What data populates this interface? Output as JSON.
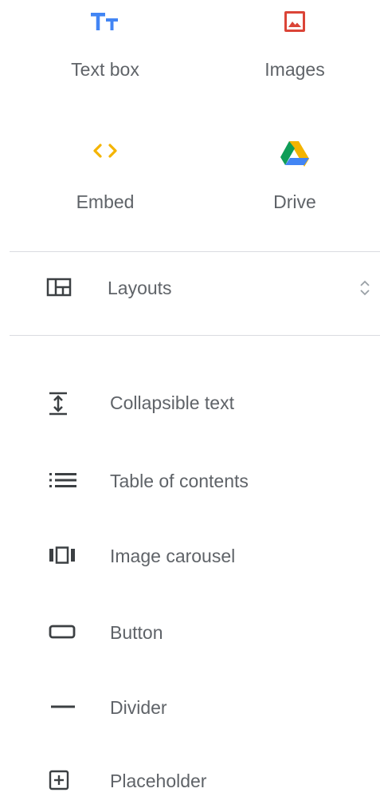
{
  "insert_tiles": [
    {
      "label": "Text box",
      "icon": "text-box-icon",
      "color": "#4285f4"
    },
    {
      "label": "Images",
      "icon": "image-icon",
      "color": "#db4437"
    },
    {
      "label": "Embed",
      "icon": "embed-code-icon",
      "color": "#f4b400"
    },
    {
      "label": "Drive",
      "icon": "google-drive-icon",
      "colors": [
        "#0f9d58",
        "#f4b400",
        "#4285f4"
      ]
    }
  ],
  "layouts": {
    "label": "Layouts",
    "icon": "layouts-icon",
    "toggle_icon": "expand-collapse-icon"
  },
  "content_blocks": [
    {
      "label": "Collapsible text",
      "icon": "collapsible-text-icon"
    },
    {
      "label": "Table of contents",
      "icon": "table-of-contents-icon"
    },
    {
      "label": "Image carousel",
      "icon": "image-carousel-icon"
    },
    {
      "label": "Button",
      "icon": "button-icon"
    },
    {
      "label": "Divider",
      "icon": "divider-icon"
    },
    {
      "label": "Placeholder",
      "icon": "placeholder-icon"
    }
  ],
  "colors": {
    "text": "#5f6368",
    "icon": "#3c4043",
    "separator": "#dadce0"
  }
}
